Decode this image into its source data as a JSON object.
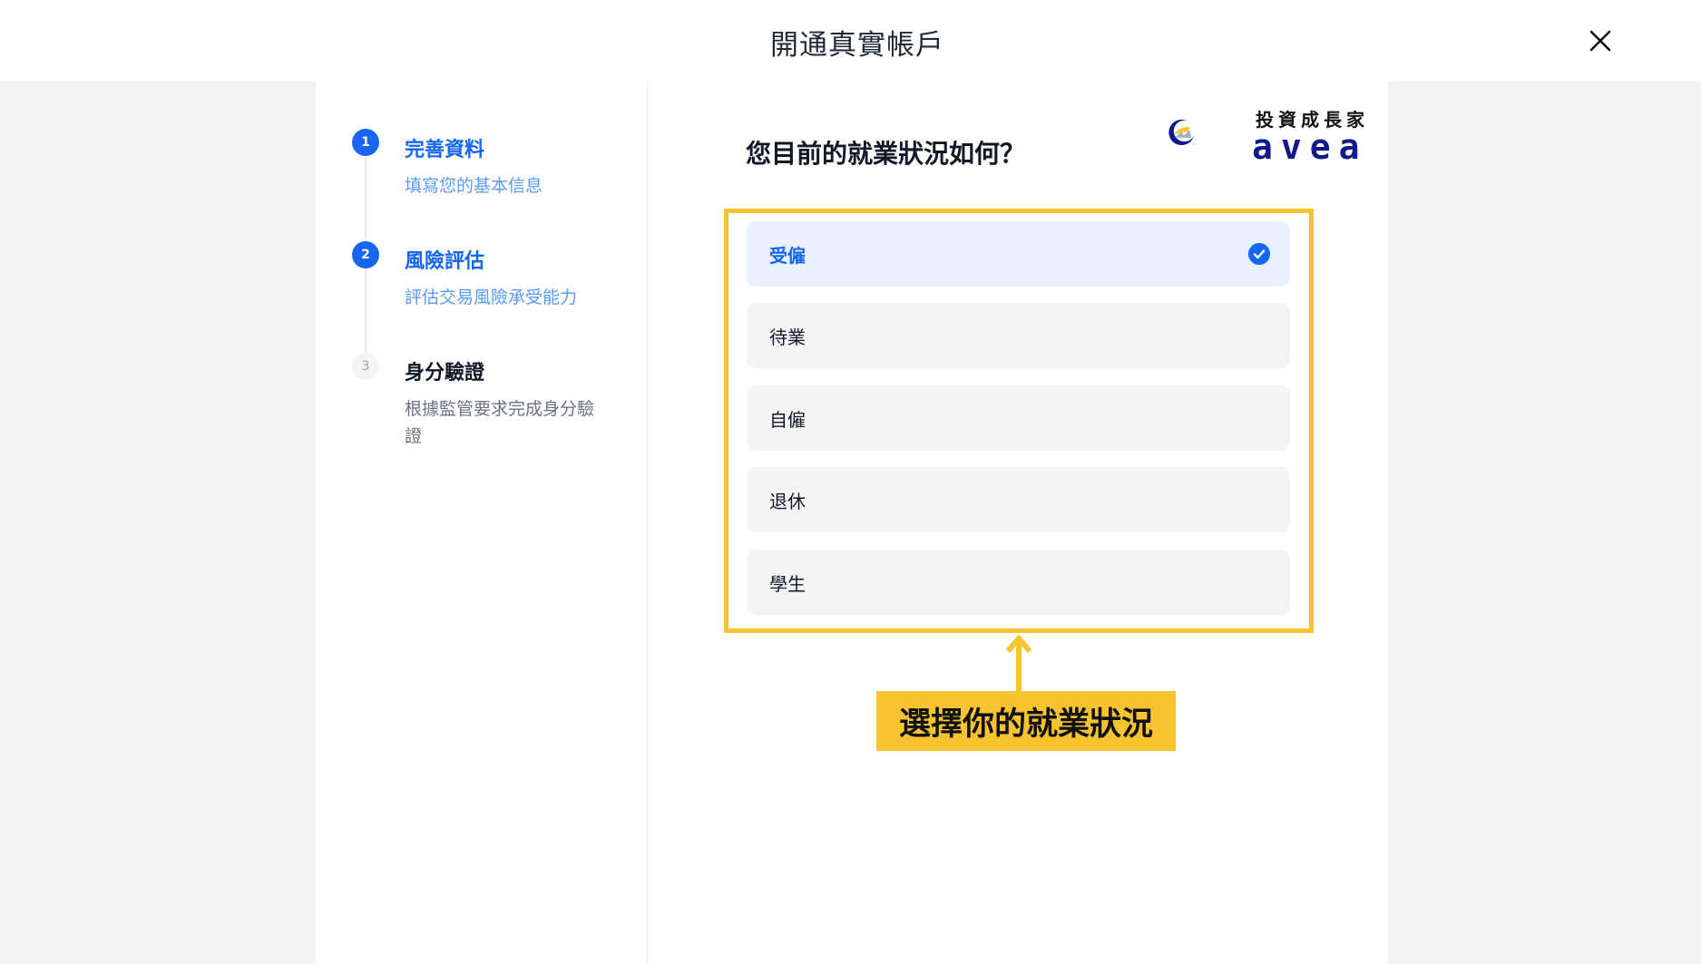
{
  "header": {
    "title": "開通真實帳戶"
  },
  "steps": [
    {
      "number": "1",
      "title": "完善資料",
      "description": "填寫您的基本信息"
    },
    {
      "number": "2",
      "title": "風險評估",
      "description": "評估交易風險承受能力"
    },
    {
      "number": "3",
      "title": "身分驗證",
      "description": "根據監管要求完成身分驗證"
    }
  ],
  "question": "您目前的就業狀況如何？",
  "options": [
    "受僱",
    "待業",
    "自僱",
    "退休",
    "學生"
  ],
  "selected_option": "受僱",
  "logo": {
    "chinese": "投資成長家",
    "english": "avea"
  },
  "annotation": "選擇你的就業狀況",
  "colors": {
    "accent": "#1666f2",
    "highlight": "#f7c331",
    "logo_navy": "#101a8c"
  }
}
